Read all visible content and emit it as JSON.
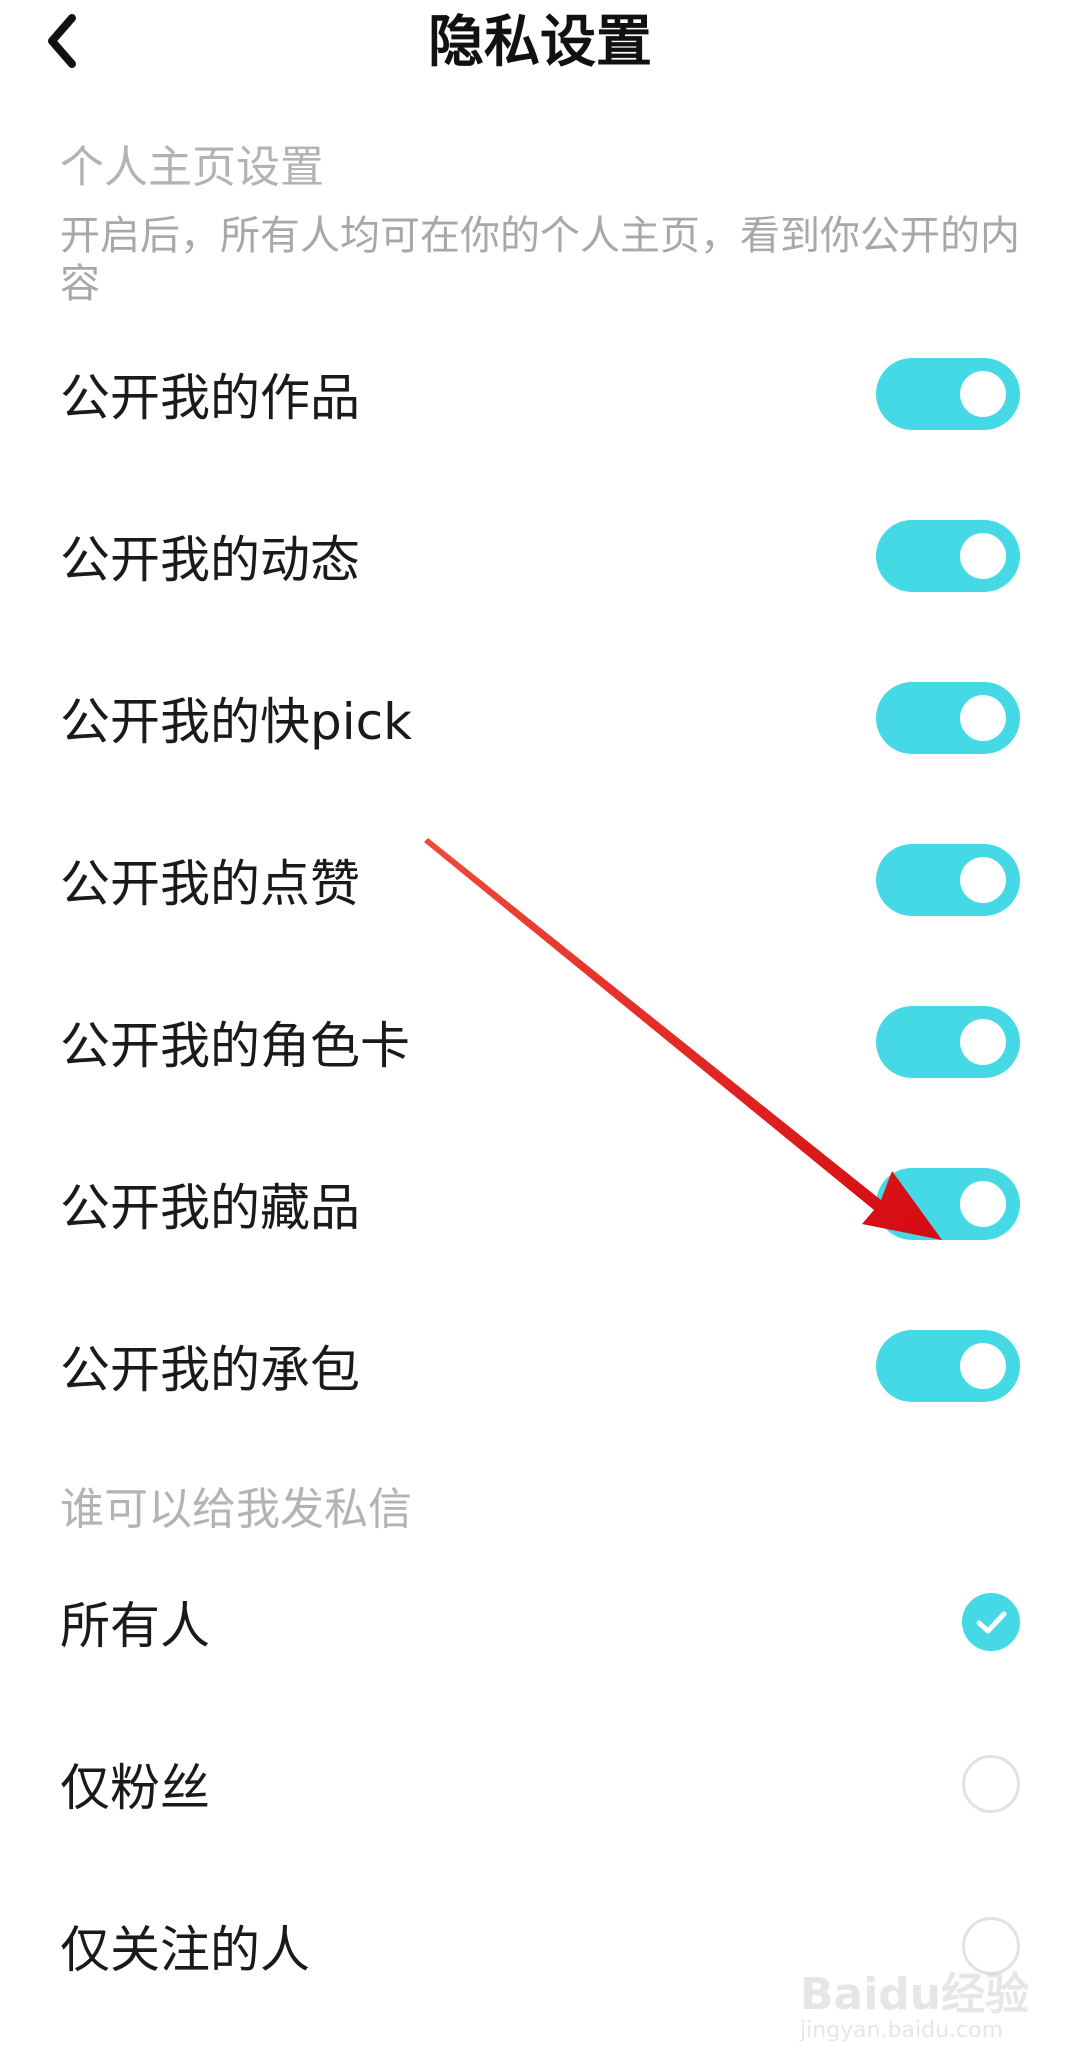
{
  "header": {
    "title": "隐私设置",
    "back_icon": "chevron-left-icon"
  },
  "homepage_section": {
    "title": "个人主页设置",
    "description": "开启后，所有人均可在你的个人主页，看到你公开的内容",
    "items": [
      {
        "label": "公开我的作品",
        "enabled": true
      },
      {
        "label": "公开我的动态",
        "enabled": true
      },
      {
        "label": "公开我的快pick",
        "enabled": true
      },
      {
        "label": "公开我的点赞",
        "enabled": true
      },
      {
        "label": "公开我的角色卡",
        "enabled": true
      },
      {
        "label": "公开我的藏品",
        "enabled": true
      },
      {
        "label": "公开我的承包",
        "enabled": true
      }
    ]
  },
  "message_section": {
    "title": "谁可以给我发私信",
    "options": [
      {
        "label": "所有人",
        "selected": true
      },
      {
        "label": "仅粉丝",
        "selected": false
      },
      {
        "label": "仅关注的人",
        "selected": false
      }
    ]
  },
  "watermark": {
    "text": "Baidu经验",
    "sub": "jingyan.baidu.com"
  },
  "colors": {
    "accent": "#45d8e5",
    "annotation_arrow": "#e8101a"
  }
}
